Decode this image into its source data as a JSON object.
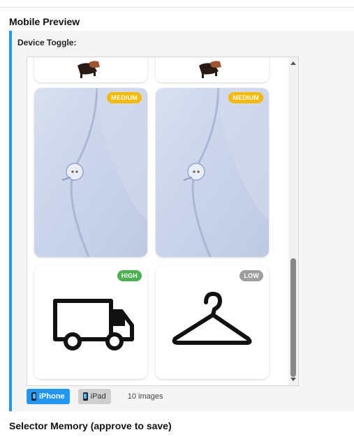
{
  "headings": {
    "mobile_preview": "Mobile Preview",
    "selector_memory": "Selector Memory (approve to save)"
  },
  "panel": {
    "toggle_label": "Device Toggle:"
  },
  "cards": [
    {
      "badge": "",
      "image": "shoes"
    },
    {
      "badge": "",
      "image": "shoes"
    },
    {
      "badge": "MEDIUM",
      "badge_color": "#f6b900",
      "image": "fabric-button"
    },
    {
      "badge": "MEDIUM",
      "badge_color": "#f6b900",
      "image": "fabric-button"
    },
    {
      "badge": "HIGH",
      "badge_color": "#4caf50",
      "image": "truck-icon"
    },
    {
      "badge": "LOW",
      "badge_color": "#9e9e9e",
      "image": "hanger-icon"
    }
  ],
  "devices": [
    {
      "label": "iPhone",
      "active": true
    },
    {
      "label": "iPad",
      "active": false
    }
  ],
  "image_count": "10 images",
  "colors": {
    "accent": "#2196f3",
    "medium": "#f6b900",
    "high": "#4caf50",
    "low": "#9e9e9e"
  }
}
